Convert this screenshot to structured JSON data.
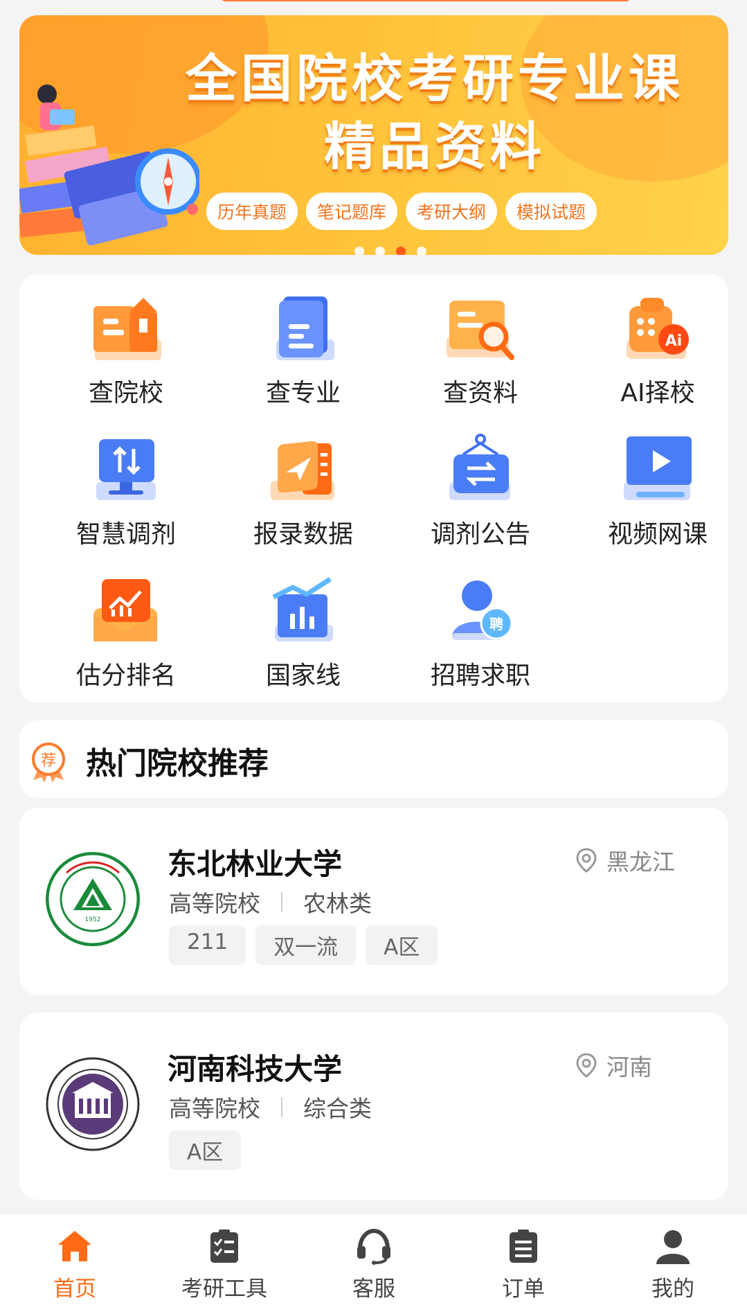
{
  "banner": {
    "title_line1": "全国院校考研专业课",
    "title_line2": "精品资料",
    "tags": [
      "历年真题",
      "笔记题库",
      "考研大纲",
      "模拟试题"
    ],
    "carousel_active_index": 2,
    "carousel_count": 4
  },
  "grid": [
    {
      "label": "查院校",
      "icon": "school-building-icon"
    },
    {
      "label": "查专业",
      "icon": "book-icon"
    },
    {
      "label": "查资料",
      "icon": "document-search-icon"
    },
    {
      "label": "AI择校",
      "icon": "ai-select-icon"
    },
    {
      "label": "智慧调剂",
      "icon": "monitor-transfer-icon"
    },
    {
      "label": "报录数据",
      "icon": "send-data-icon"
    },
    {
      "label": "调剂公告",
      "icon": "announcement-icon"
    },
    {
      "label": "视频网课",
      "icon": "video-course-icon"
    },
    {
      "label": "估分排名",
      "icon": "score-rank-icon"
    },
    {
      "label": "国家线",
      "icon": "national-line-chart-icon"
    },
    {
      "label": "招聘求职",
      "icon": "recruitment-icon"
    }
  ],
  "section": {
    "title": "热门院校推荐",
    "badge_text": "荐"
  },
  "schools": [
    {
      "name": "东北林业大学",
      "type": "高等院校",
      "category": "农林类",
      "tags": [
        "211",
        "双一流",
        "A区"
      ],
      "location": "黑龙江",
      "logo_year": "1952"
    },
    {
      "name": "河南科技大学",
      "type": "高等院校",
      "category": "综合类",
      "tags": [
        "A区"
      ],
      "location": "河南"
    }
  ],
  "nav": {
    "items": [
      {
        "label": "首页",
        "icon": "home-icon",
        "active": true
      },
      {
        "label": "考研工具",
        "icon": "checklist-icon",
        "active": false
      },
      {
        "label": "客服",
        "icon": "headset-icon",
        "active": false
      },
      {
        "label": "订单",
        "icon": "order-icon",
        "active": false
      },
      {
        "label": "我的",
        "icon": "user-icon",
        "active": false
      }
    ]
  },
  "colors": {
    "accent": "#ff6a14",
    "banner": "#ffc23a"
  }
}
